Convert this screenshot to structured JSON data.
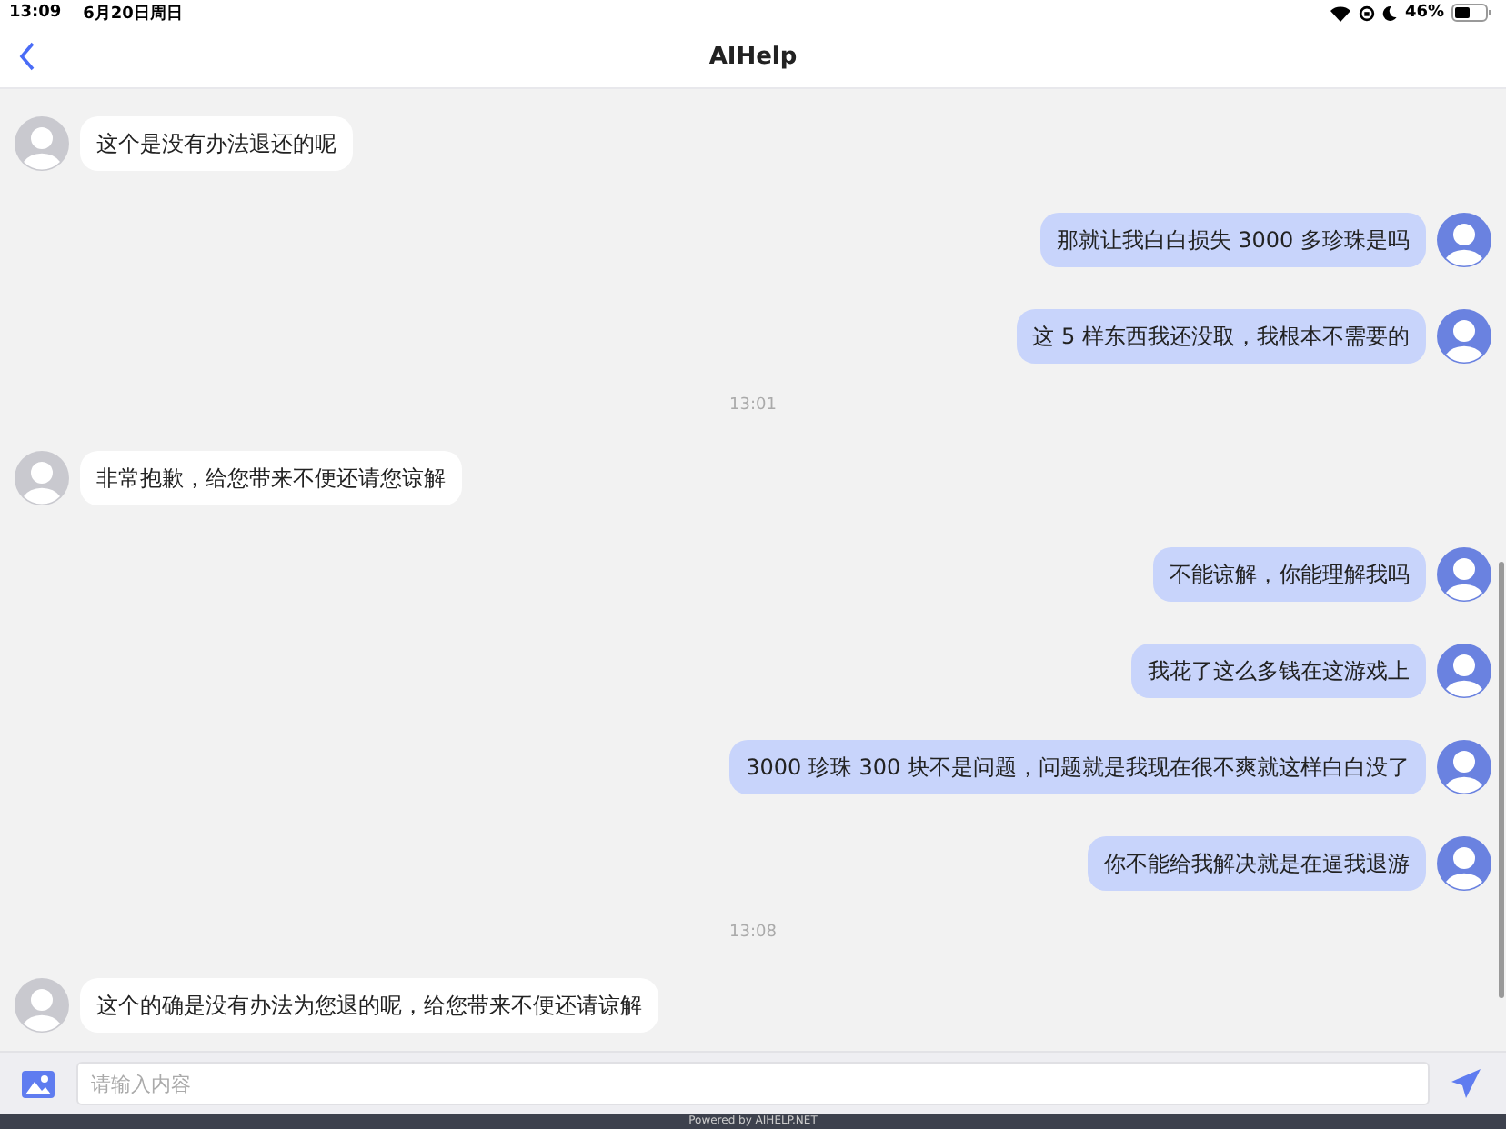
{
  "status_bar": {
    "time": "13:09",
    "date": "6月20日周日",
    "battery": "46%"
  },
  "header": {
    "title": "AIHelp"
  },
  "messages": [
    {
      "kind": "agent",
      "text": "这个是没有办法退还的呢"
    },
    {
      "kind": "user",
      "text": "那就让我白白损失 3000 多珍珠是吗"
    },
    {
      "kind": "user",
      "text": "这 5 样东西我还没取，我根本不需要的"
    },
    {
      "kind": "time",
      "text": "13:01"
    },
    {
      "kind": "agent",
      "text": "非常抱歉，给您带来不便还请您谅解"
    },
    {
      "kind": "user",
      "text": "不能谅解，你能理解我吗"
    },
    {
      "kind": "user",
      "text": "我花了这么多钱在这游戏上"
    },
    {
      "kind": "user",
      "text": "3000 珍珠 300 块不是问题，问题就是我现在很不爽就这样白白没了"
    },
    {
      "kind": "user",
      "text": "你不能给我解决就是在逼我退游"
    },
    {
      "kind": "time",
      "text": "13:08"
    },
    {
      "kind": "agent",
      "text": "这个的确是没有办法为您退的呢，给您带来不便还请谅解"
    }
  ],
  "input": {
    "placeholder": "请输入内容"
  },
  "footer": {
    "text": "Powered by AIHELP.NET"
  }
}
